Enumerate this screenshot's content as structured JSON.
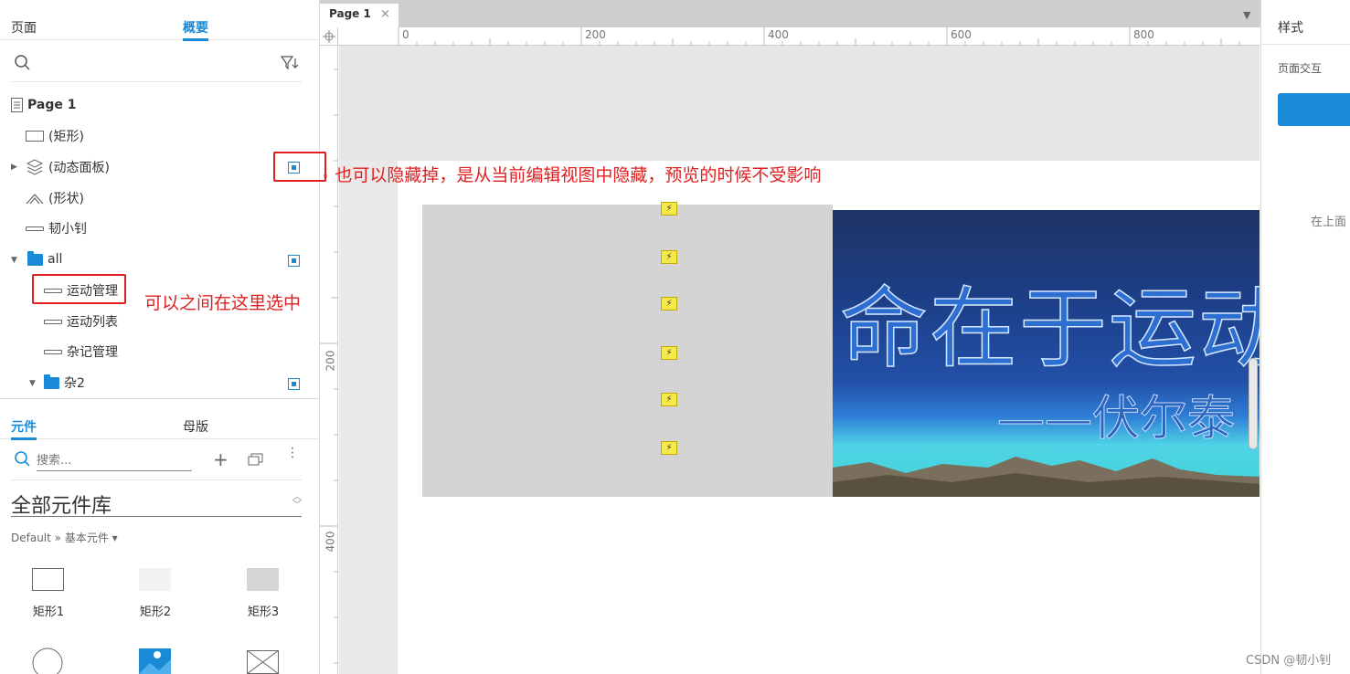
{
  "left_panel": {
    "top_tabs": [
      "页面",
      "概要"
    ],
    "outline_items": [
      {
        "label": "Page 1"
      },
      {
        "label": "(矩形)"
      },
      {
        "label": "(动态面板)"
      },
      {
        "label": "(形状)"
      },
      {
        "label": "韧小钊"
      },
      {
        "label": "all"
      },
      {
        "label": "运动管理"
      },
      {
        "label": "运动列表"
      },
      {
        "label": "杂记管理"
      },
      {
        "label": "杂2"
      }
    ],
    "bottom_tabs": [
      "元件",
      "母版"
    ],
    "search_placeholder": "搜索...",
    "library_name": "全部元件库",
    "breadcrumb": "Default » 基本元件 ▾",
    "widgets": [
      "矩形1",
      "矩形2",
      "矩形3"
    ]
  },
  "annotations": {
    "hide_note": "也可以隐藏掉，是从当前编辑视图中隐藏，预览的时候不受影响",
    "select_note": "可以之间在这里选中"
  },
  "canvas": {
    "page_tab": "Page 1",
    "ruler_top": [
      "0",
      "200",
      "400",
      "600",
      "800"
    ],
    "ruler_left": [
      "200",
      "400"
    ],
    "banner_title": "命在于运动",
    "banner_sub": "——伏尔泰"
  },
  "right_panel": {
    "title": "样式",
    "section": "页面交互",
    "hint": "在上面"
  },
  "watermark": "CSDN @韧小钊",
  "colors": {
    "accent": "#1a8ad6",
    "annotation": "#e02020"
  }
}
